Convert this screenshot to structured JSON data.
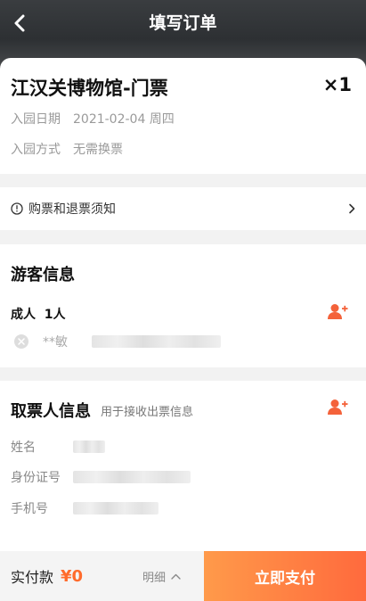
{
  "header": {
    "title": "填写订单"
  },
  "ticket": {
    "name": "江汉关博物馆-门票",
    "quantity": "×1",
    "date_label": "入园日期",
    "date_value": "2021-02-04 周四",
    "entry_label": "入园方式",
    "entry_value": "无需换票"
  },
  "notice": {
    "label": "购票和退票须知"
  },
  "visitor": {
    "title": "游客信息",
    "adult_label": "成人",
    "adult_count": "1人",
    "visitor_name": "**敏"
  },
  "pickup": {
    "title": "取票人信息",
    "subtitle": "用于接收出票信息",
    "name_label": "姓名",
    "id_label": "身份证号",
    "phone_label": "手机号"
  },
  "footer": {
    "pay_label": "实付款",
    "pay_amount": "¥0",
    "detail_label": "明细",
    "pay_button": "立即支付"
  },
  "colors": {
    "accent": "#ff6b2c",
    "header_bg": "#2d3033"
  }
}
